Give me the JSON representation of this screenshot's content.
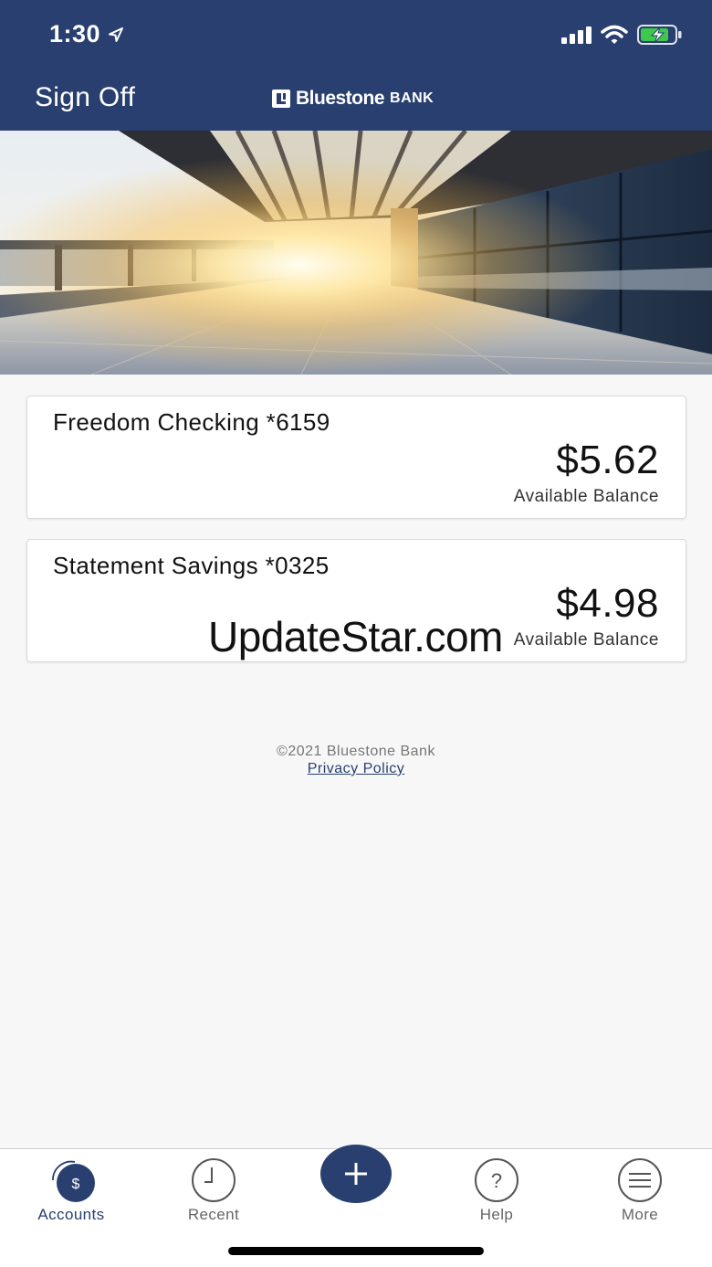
{
  "status_bar": {
    "time": "1:30",
    "icons": [
      "location-arrow-icon",
      "signal-icon",
      "wifi-icon",
      "battery-charging-icon"
    ]
  },
  "header": {
    "sign_off": "Sign Off",
    "brand_name": "Bluestone",
    "brand_suffix": "BANK",
    "background": "#283f6f"
  },
  "accounts": [
    {
      "name": "Freedom Checking *6159",
      "balance": "$5.62",
      "balance_label": "Available Balance"
    },
    {
      "name": "Statement Savings *0325",
      "balance": "$4.98",
      "balance_label": "Available Balance"
    }
  ],
  "watermark": "UpdateStar.com",
  "footer": {
    "copyright": "©2021 Bluestone Bank",
    "privacy_link": "Privacy Policy"
  },
  "tabs": [
    {
      "label": "Accounts",
      "icon": "dollar-icon",
      "active": true
    },
    {
      "label": "Recent",
      "icon": "clock-icon",
      "active": false
    },
    {
      "label": "",
      "icon": "plus-icon",
      "active": false
    },
    {
      "label": "Help",
      "icon": "question-icon",
      "active": false
    },
    {
      "label": "More",
      "icon": "menu-icon",
      "active": false
    }
  ],
  "colors": {
    "brand_navy": "#283f6f",
    "background": "#f7f7f8",
    "card": "#ffffff"
  }
}
